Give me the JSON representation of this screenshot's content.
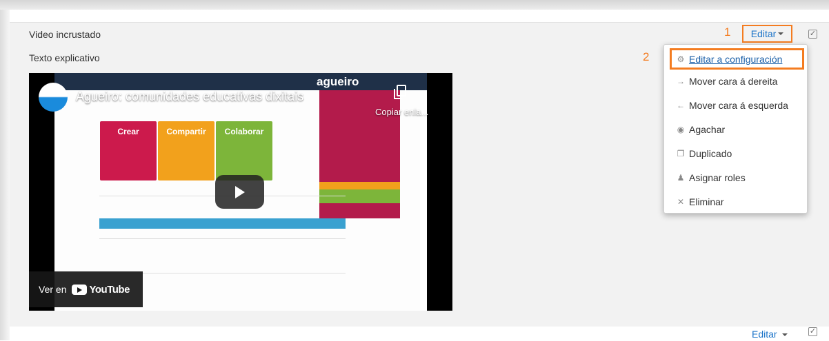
{
  "activity": {
    "title": "Video incrustado",
    "description": "Texto explicativo",
    "edit_label": "Editar",
    "step_1": "1",
    "step_2": "2"
  },
  "menu": {
    "items": [
      {
        "label": "Editar a configuración",
        "icon": "gear-icon"
      },
      {
        "label": "Mover cara á dereita",
        "icon": "arrow-right-icon"
      },
      {
        "label": "Mover cara á esquerda",
        "icon": "arrow-left-icon"
      },
      {
        "label": "Agachar",
        "icon": "eye-icon"
      },
      {
        "label": "Duplicado",
        "icon": "copy-icon"
      },
      {
        "label": "Asignar roles",
        "icon": "user-plus-icon"
      },
      {
        "label": "Eliminar",
        "icon": "close-icon"
      }
    ]
  },
  "video": {
    "title": "Agueiro: comunidades educativas dixitais",
    "copy_link": "Copiar enla...",
    "watch_on": "Ver en",
    "youtube_word": "YouTube",
    "screen_logo": "agueiro",
    "puzzle_labels": [
      "Crear",
      "Compartir",
      "Colaborar"
    ]
  },
  "next_activity": {
    "edit_label": "Editar"
  },
  "colors": {
    "highlight": "#f47c20",
    "link": "#1a73c8",
    "section_bg": "#f2f2f2"
  }
}
